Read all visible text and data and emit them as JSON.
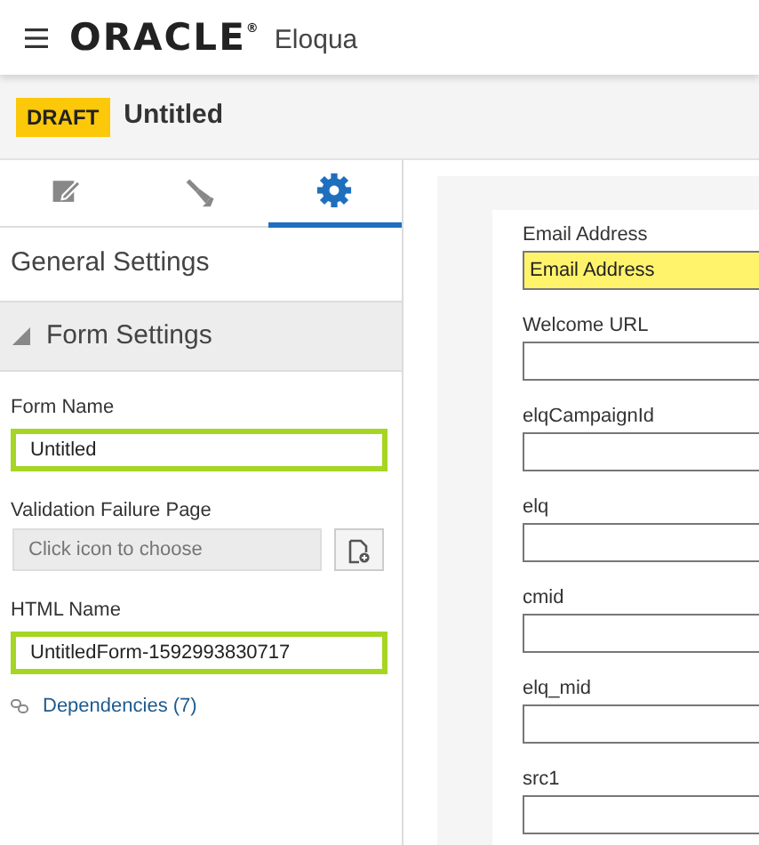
{
  "header": {
    "brand": "ORACLE$^{®}$",
    "product": "Eloqua"
  },
  "asset": {
    "status": "DRAFT",
    "title": "Untitled"
  },
  "tabs": [
    {
      "kind": "edit",
      "selected": false
    },
    {
      "kind": "style",
      "selected": false
    },
    {
      "kind": "settings",
      "selected": true
    }
  ],
  "panel": {
    "title": "General Settings",
    "section": {
      "title": "Form Settings",
      "expanded": true
    },
    "fields": [
      {
        "kind": "text",
        "label": "Form Name",
        "value": "Untitled",
        "highlighted": true
      },
      {
        "kind": "picker",
        "label": "Validation Failure Page",
        "placeholder": "Click icon to choose",
        "highlighted": false
      },
      {
        "kind": "text",
        "label": "HTML Name",
        "value": "UntitledForm-1592993830717",
        "highlighted": true
      }
    ],
    "link": "Dependencies (7)"
  },
  "form_fields": [
    {
      "label": "Email Address",
      "value": "Email Address",
      "highlighted": true
    },
    {
      "label": "Welcome URL",
      "highlighted": false
    },
    {
      "label": "elqCampaignId",
      "highlighted": false
    },
    {
      "label": "elq",
      "highlighted": false
    },
    {
      "label": "cmid",
      "highlighted": false
    },
    {
      "label": "elq_mid",
      "highlighted": false
    },
    {
      "label": "src1",
      "highlighted": false
    }
  ]
}
